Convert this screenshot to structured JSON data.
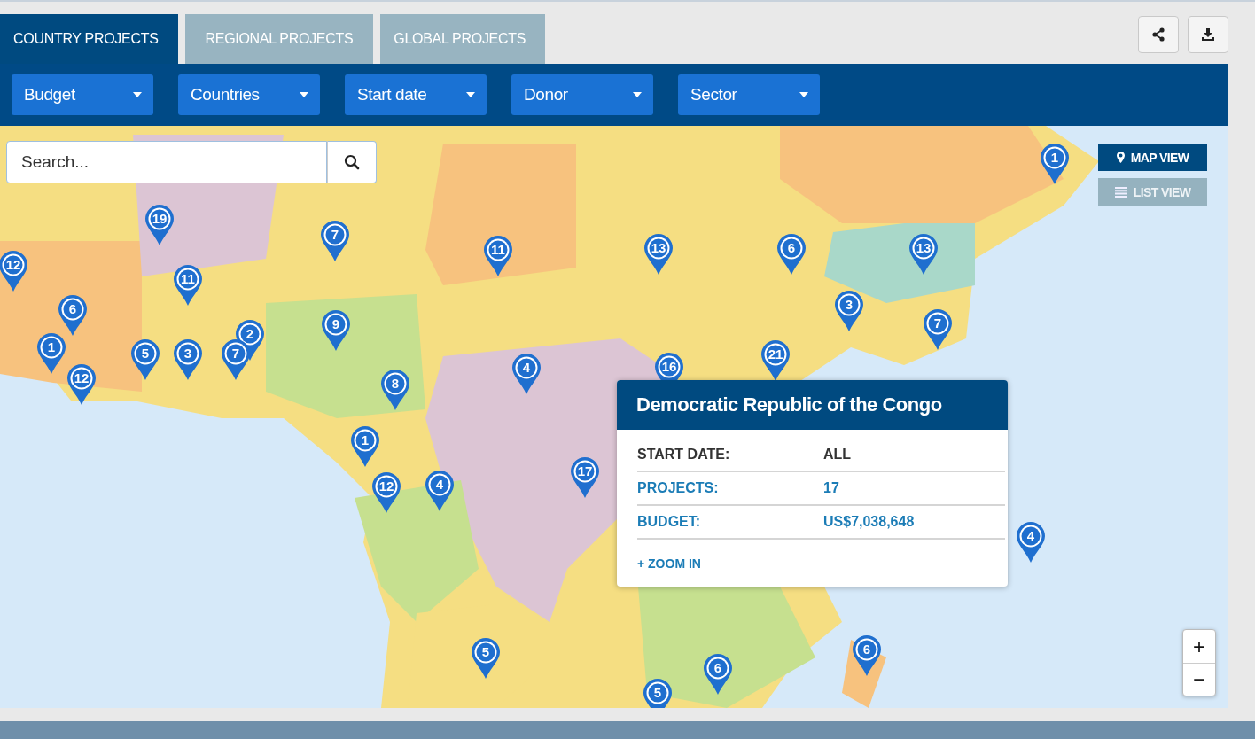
{
  "tabs": [
    {
      "label": "COUNTRY PROJECTS",
      "selected": true
    },
    {
      "label": "REGIONAL PROJECTS",
      "selected": false
    },
    {
      "label": "GLOBAL PROJECTS",
      "selected": false
    }
  ],
  "filters": [
    "Budget",
    "Countries",
    "Start date",
    "Donor",
    "Sector"
  ],
  "search": {
    "placeholder": "Search..."
  },
  "view_toggle": [
    {
      "label": "MAP VIEW",
      "selected": true,
      "kind": "map"
    },
    {
      "label": "LIST VIEW",
      "selected": false,
      "kind": "list"
    }
  ],
  "pins": [
    {
      "count": "19"
    },
    {
      "count": "12"
    },
    {
      "count": "7"
    },
    {
      "count": "11"
    },
    {
      "count": "13"
    },
    {
      "count": "6"
    },
    {
      "count": "13"
    },
    {
      "count": "1"
    },
    {
      "count": "11"
    },
    {
      "count": "6"
    },
    {
      "count": "2"
    },
    {
      "count": "9"
    },
    {
      "count": "3"
    },
    {
      "count": "7"
    },
    {
      "count": "1"
    },
    {
      "count": "5"
    },
    {
      "count": "3"
    },
    {
      "count": "7"
    },
    {
      "count": "16"
    },
    {
      "count": "21"
    },
    {
      "count": "4"
    },
    {
      "count": "12"
    },
    {
      "count": "8"
    },
    {
      "count": "1"
    },
    {
      "count": "17"
    },
    {
      "count": "12"
    },
    {
      "count": "4"
    },
    {
      "count": "4"
    },
    {
      "count": "5"
    },
    {
      "count": "6"
    },
    {
      "count": "6"
    },
    {
      "count": "5"
    }
  ],
  "tooltip": {
    "title": "Democratic Republic of the Congo",
    "rows": [
      {
        "label": "START DATE:",
        "value": "ALL",
        "kind": "plain"
      },
      {
        "label": "PROJECTS:",
        "value": "17",
        "kind": "link"
      },
      {
        "label": "BUDGET:",
        "value": "US$7,038,648",
        "kind": "link"
      }
    ],
    "link": "+ ZOOM IN"
  },
  "zoom_controls": [
    "+",
    "−"
  ]
}
